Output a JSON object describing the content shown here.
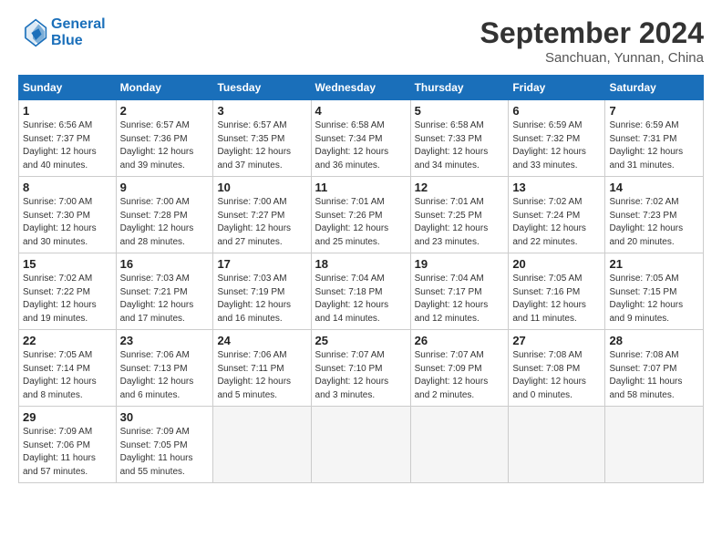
{
  "header": {
    "logo_line1": "General",
    "logo_line2": "Blue",
    "month": "September 2024",
    "location": "Sanchuan, Yunnan, China"
  },
  "weekdays": [
    "Sunday",
    "Monday",
    "Tuesday",
    "Wednesday",
    "Thursday",
    "Friday",
    "Saturday"
  ],
  "weeks": [
    [
      {
        "day": "1",
        "info": "Sunrise: 6:56 AM\nSunset: 7:37 PM\nDaylight: 12 hours\nand 40 minutes."
      },
      {
        "day": "2",
        "info": "Sunrise: 6:57 AM\nSunset: 7:36 PM\nDaylight: 12 hours\nand 39 minutes."
      },
      {
        "day": "3",
        "info": "Sunrise: 6:57 AM\nSunset: 7:35 PM\nDaylight: 12 hours\nand 37 minutes."
      },
      {
        "day": "4",
        "info": "Sunrise: 6:58 AM\nSunset: 7:34 PM\nDaylight: 12 hours\nand 36 minutes."
      },
      {
        "day": "5",
        "info": "Sunrise: 6:58 AM\nSunset: 7:33 PM\nDaylight: 12 hours\nand 34 minutes."
      },
      {
        "day": "6",
        "info": "Sunrise: 6:59 AM\nSunset: 7:32 PM\nDaylight: 12 hours\nand 33 minutes."
      },
      {
        "day": "7",
        "info": "Sunrise: 6:59 AM\nSunset: 7:31 PM\nDaylight: 12 hours\nand 31 minutes."
      }
    ],
    [
      {
        "day": "8",
        "info": "Sunrise: 7:00 AM\nSunset: 7:30 PM\nDaylight: 12 hours\nand 30 minutes."
      },
      {
        "day": "9",
        "info": "Sunrise: 7:00 AM\nSunset: 7:28 PM\nDaylight: 12 hours\nand 28 minutes."
      },
      {
        "day": "10",
        "info": "Sunrise: 7:00 AM\nSunset: 7:27 PM\nDaylight: 12 hours\nand 27 minutes."
      },
      {
        "day": "11",
        "info": "Sunrise: 7:01 AM\nSunset: 7:26 PM\nDaylight: 12 hours\nand 25 minutes."
      },
      {
        "day": "12",
        "info": "Sunrise: 7:01 AM\nSunset: 7:25 PM\nDaylight: 12 hours\nand 23 minutes."
      },
      {
        "day": "13",
        "info": "Sunrise: 7:02 AM\nSunset: 7:24 PM\nDaylight: 12 hours\nand 22 minutes."
      },
      {
        "day": "14",
        "info": "Sunrise: 7:02 AM\nSunset: 7:23 PM\nDaylight: 12 hours\nand 20 minutes."
      }
    ],
    [
      {
        "day": "15",
        "info": "Sunrise: 7:02 AM\nSunset: 7:22 PM\nDaylight: 12 hours\nand 19 minutes."
      },
      {
        "day": "16",
        "info": "Sunrise: 7:03 AM\nSunset: 7:21 PM\nDaylight: 12 hours\nand 17 minutes."
      },
      {
        "day": "17",
        "info": "Sunrise: 7:03 AM\nSunset: 7:19 PM\nDaylight: 12 hours\nand 16 minutes."
      },
      {
        "day": "18",
        "info": "Sunrise: 7:04 AM\nSunset: 7:18 PM\nDaylight: 12 hours\nand 14 minutes."
      },
      {
        "day": "19",
        "info": "Sunrise: 7:04 AM\nSunset: 7:17 PM\nDaylight: 12 hours\nand 12 minutes."
      },
      {
        "day": "20",
        "info": "Sunrise: 7:05 AM\nSunset: 7:16 PM\nDaylight: 12 hours\nand 11 minutes."
      },
      {
        "day": "21",
        "info": "Sunrise: 7:05 AM\nSunset: 7:15 PM\nDaylight: 12 hours\nand 9 minutes."
      }
    ],
    [
      {
        "day": "22",
        "info": "Sunrise: 7:05 AM\nSunset: 7:14 PM\nDaylight: 12 hours\nand 8 minutes."
      },
      {
        "day": "23",
        "info": "Sunrise: 7:06 AM\nSunset: 7:13 PM\nDaylight: 12 hours\nand 6 minutes."
      },
      {
        "day": "24",
        "info": "Sunrise: 7:06 AM\nSunset: 7:11 PM\nDaylight: 12 hours\nand 5 minutes."
      },
      {
        "day": "25",
        "info": "Sunrise: 7:07 AM\nSunset: 7:10 PM\nDaylight: 12 hours\nand 3 minutes."
      },
      {
        "day": "26",
        "info": "Sunrise: 7:07 AM\nSunset: 7:09 PM\nDaylight: 12 hours\nand 2 minutes."
      },
      {
        "day": "27",
        "info": "Sunrise: 7:08 AM\nSunset: 7:08 PM\nDaylight: 12 hours\nand 0 minutes."
      },
      {
        "day": "28",
        "info": "Sunrise: 7:08 AM\nSunset: 7:07 PM\nDaylight: 11 hours\nand 58 minutes."
      }
    ],
    [
      {
        "day": "29",
        "info": "Sunrise: 7:09 AM\nSunset: 7:06 PM\nDaylight: 11 hours\nand 57 minutes."
      },
      {
        "day": "30",
        "info": "Sunrise: 7:09 AM\nSunset: 7:05 PM\nDaylight: 11 hours\nand 55 minutes."
      },
      {
        "day": "",
        "info": ""
      },
      {
        "day": "",
        "info": ""
      },
      {
        "day": "",
        "info": ""
      },
      {
        "day": "",
        "info": ""
      },
      {
        "day": "",
        "info": ""
      }
    ]
  ]
}
